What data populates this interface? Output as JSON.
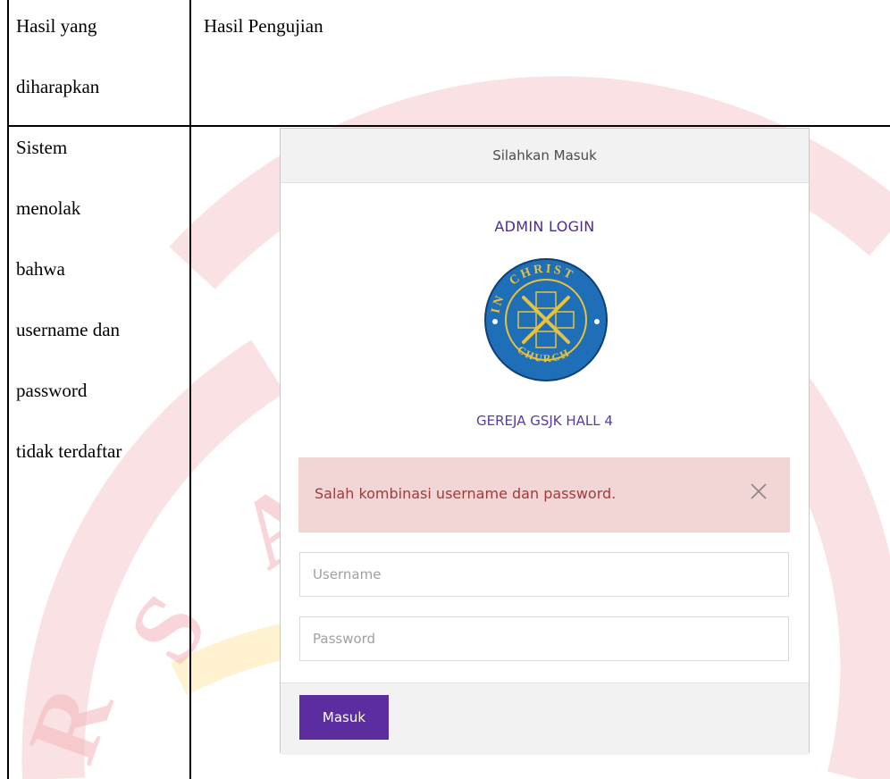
{
  "table": {
    "header_col1_line1": "Hasil yang",
    "header_col1_line2": "diharapkan",
    "header_col2": "Hasil Pengujian",
    "expected_lines": [
      "Sistem",
      "menolak",
      "bahwa",
      "username dan",
      "password",
      "tidak terdaftar"
    ]
  },
  "login": {
    "panel_title": "Silahkan Masuk",
    "admin_title": "ADMIN LOGIN",
    "logo_text_top": "CHRIST",
    "logo_text_left": "IN",
    "logo_text_bottom": "CHURCH",
    "church_name": "GEREJA GSJK HALL 4",
    "error_message": "Salah kombinasi username dan password.",
    "username_placeholder": "Username",
    "password_placeholder": "Password",
    "submit_label": "Masuk"
  },
  "colors": {
    "accent_purple": "#5b2d9e",
    "alert_bg": "#f2d6d6",
    "alert_text": "#a33a3a",
    "logo_blue": "#1f6fb8",
    "logo_gold": "#e8c23a"
  }
}
